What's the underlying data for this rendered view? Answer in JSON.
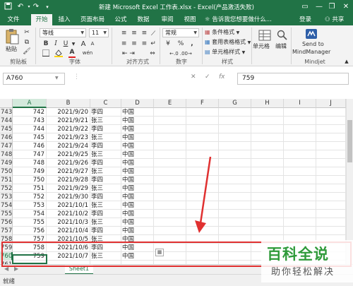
{
  "title_bar": {
    "title": "新建 Microsoft Excel 工作表.xlsx - Excel(产品激活失败)"
  },
  "tabs": [
    "文件",
    "开始",
    "插入",
    "页面布局",
    "公式",
    "数据",
    "审阅",
    "视图"
  ],
  "tell_me": "告诉我您想要做什么...",
  "login": "登录",
  "share": "共享",
  "ribbon": {
    "clipboard": {
      "paste_label": "粘贴",
      "group_label": "剪贴板"
    },
    "font": {
      "name": "等线",
      "size": "11",
      "group_label": "字体",
      "bold": "B",
      "italic": "I",
      "underline": "U",
      "grow": "A",
      "shrink": "A",
      "font_color_letter": "A",
      "phonetic": "wén"
    },
    "alignment": {
      "group_label": "对齐方式"
    },
    "number": {
      "format": "常规",
      "group_label": "数字",
      "percent": "%",
      "comma": ",",
      "currency": "¥"
    },
    "styles": {
      "conditional": "条件格式",
      "table": "套用表格格式",
      "cell_styles": "单元格样式",
      "group_label": "样式"
    },
    "cells": {
      "label": "单元格"
    },
    "editing": {
      "label": "编辑"
    },
    "mindjet": {
      "label1": "Send to",
      "label2": "MindManager",
      "group_label": "Mindjet"
    }
  },
  "formula_bar": {
    "name_box": "A760",
    "cancel": "✕",
    "enter": "✓",
    "fx": "fx",
    "value": "759"
  },
  "grid": {
    "columns": [
      "A",
      "B",
      "C",
      "D",
      "E",
      "F",
      "G",
      "H",
      "I",
      "J"
    ],
    "selected_column": "A",
    "selected_row": "760",
    "rows": [
      {
        "n": "743",
        "a": "742",
        "b": "2021/9/20",
        "c": "李四",
        "d": "中国"
      },
      {
        "n": "744",
        "a": "743",
        "b": "2021/9/21",
        "c": "张三",
        "d": "中国"
      },
      {
        "n": "745",
        "a": "744",
        "b": "2021/9/22",
        "c": "李四",
        "d": "中国"
      },
      {
        "n": "746",
        "a": "745",
        "b": "2021/9/23",
        "c": "张三",
        "d": "中国"
      },
      {
        "n": "747",
        "a": "746",
        "b": "2021/9/24",
        "c": "李四",
        "d": "中国"
      },
      {
        "n": "748",
        "a": "747",
        "b": "2021/9/25",
        "c": "张三",
        "d": "中国"
      },
      {
        "n": "749",
        "a": "748",
        "b": "2021/9/26",
        "c": "李四",
        "d": "中国"
      },
      {
        "n": "750",
        "a": "749",
        "b": "2021/9/27",
        "c": "张三",
        "d": "中国"
      },
      {
        "n": "751",
        "a": "750",
        "b": "2021/9/28",
        "c": "李四",
        "d": "中国"
      },
      {
        "n": "752",
        "a": "751",
        "b": "2021/9/29",
        "c": "张三",
        "d": "中国"
      },
      {
        "n": "753",
        "a": "752",
        "b": "2021/9/30",
        "c": "李四",
        "d": "中国"
      },
      {
        "n": "754",
        "a": "753",
        "b": "2021/10/1",
        "c": "张三",
        "d": "中国"
      },
      {
        "n": "755",
        "a": "754",
        "b": "2021/10/2",
        "c": "李四",
        "d": "中国"
      },
      {
        "n": "756",
        "a": "755",
        "b": "2021/10/3",
        "c": "张三",
        "d": "中国"
      },
      {
        "n": "757",
        "a": "756",
        "b": "2021/10/4",
        "c": "李四",
        "d": "中国"
      },
      {
        "n": "758",
        "a": "757",
        "b": "2021/10/5",
        "c": "张三",
        "d": "中国"
      },
      {
        "n": "759",
        "a": "758",
        "b": "2021/10/6",
        "c": "李四",
        "d": "中国"
      },
      {
        "n": "760",
        "a": "759",
        "b": "2021/10/7",
        "c": "张三",
        "d": "中国"
      },
      {
        "n": "761",
        "a": "",
        "b": "",
        "c": "",
        "d": ""
      }
    ]
  },
  "sheet_tab": "Sheet1",
  "status": "就绪",
  "watermark": {
    "big": "百科全说",
    "small": "助你轻松解决"
  },
  "colors": {
    "accent": "#217346",
    "annotation": "#e03030",
    "watermark_green": "#2f9a3a"
  }
}
